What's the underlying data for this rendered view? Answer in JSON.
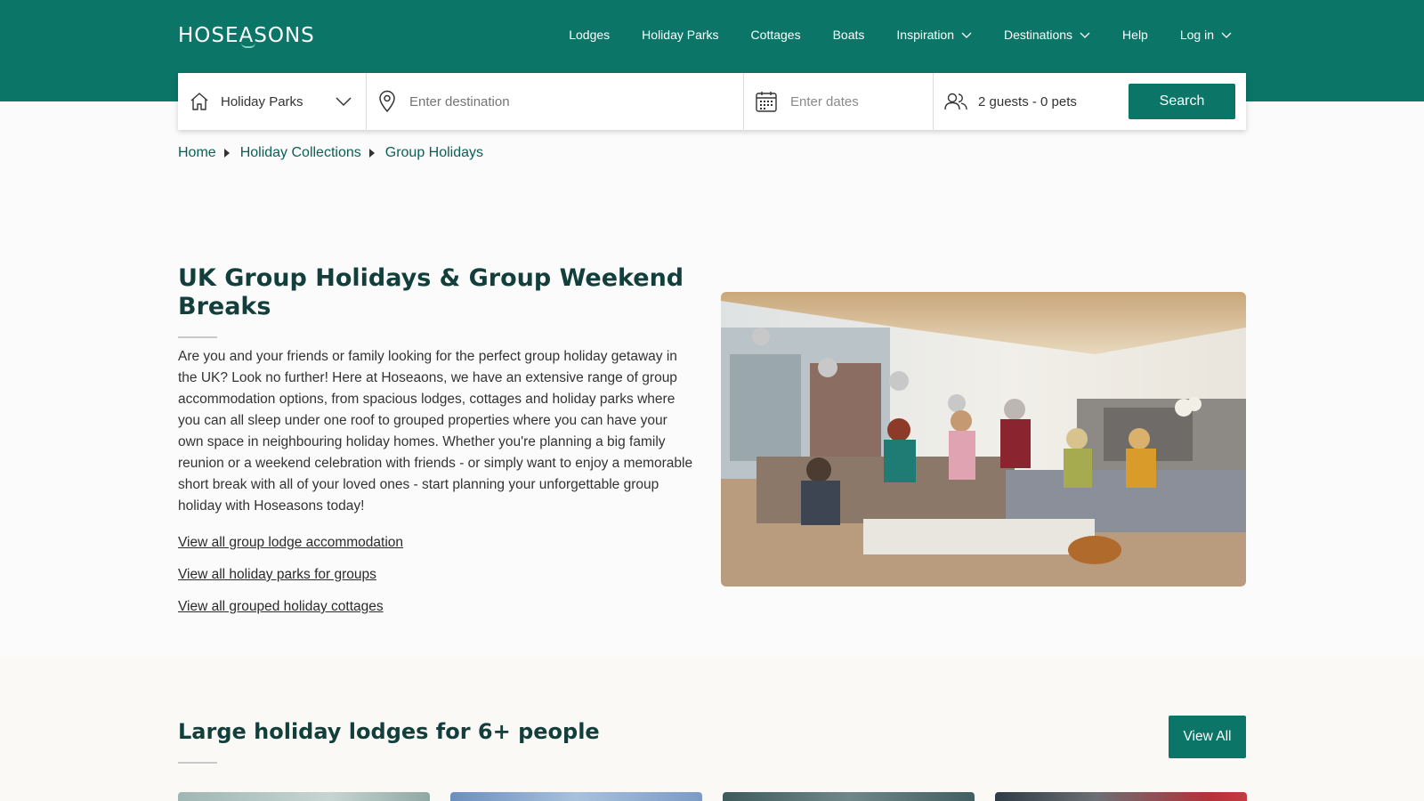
{
  "header": {
    "logo": "HOSEASONS",
    "nav": [
      {
        "label": "Lodges",
        "dropdown": false
      },
      {
        "label": "Holiday Parks",
        "dropdown": false
      },
      {
        "label": "Cottages",
        "dropdown": false
      },
      {
        "label": "Boats",
        "dropdown": false
      },
      {
        "label": "Inspiration",
        "dropdown": true
      },
      {
        "label": "Destinations",
        "dropdown": true
      },
      {
        "label": "Help",
        "dropdown": false
      },
      {
        "label": "Log in",
        "dropdown": true
      }
    ]
  },
  "search": {
    "type_value": "Holiday Parks",
    "destination_placeholder": "Enter destination",
    "dates_placeholder": "Enter dates",
    "guests_value": "2 guests - 0 pets",
    "button_label": "Search"
  },
  "breadcrumb": [
    "Home",
    "Holiday Collections",
    "Group Holidays"
  ],
  "hero": {
    "title": "UK Group Holidays & Group Weekend Breaks",
    "body": "Are you and your friends or family looking for the perfect group holiday getaway in the UK? Look no further! Here at Hoseaons, we have an extensive range of group accommodation options, from spacious lodges, cottages and holiday parks where you can all sleep under one roof to grouped properties where you can have your own space in neighbouring holiday homes. Whether you're planning a big family reunion or a weekend celebration with friends - or simply want to enjoy a memorable short break with all of your loved ones - start planning your unforgettable group holiday with Hoseasons today!",
    "links": [
      "View all group lodge accommodation",
      "View all holiday parks for groups",
      "View all grouped holiday cottages"
    ]
  },
  "section": {
    "title": "Large holiday lodges for 6+ people",
    "view_all_label": "View All"
  },
  "colors": {
    "brand": "#0b7568",
    "heading": "#123f3b",
    "link": "#0b5f56"
  }
}
